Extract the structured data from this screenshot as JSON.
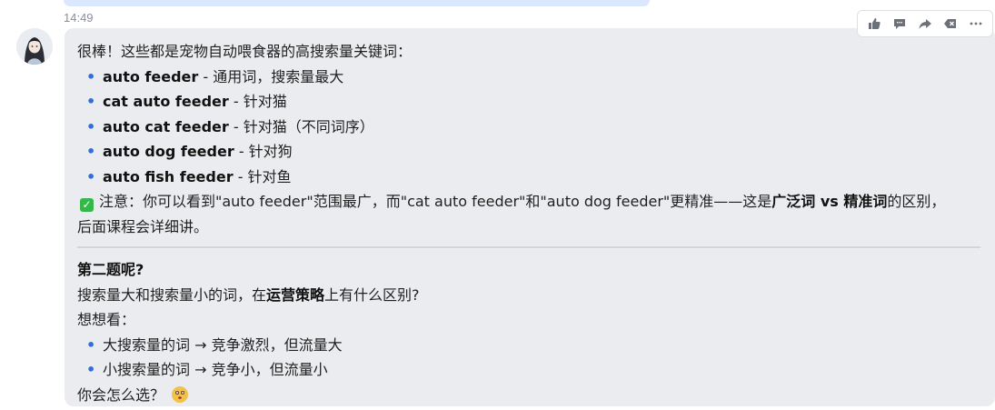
{
  "timestamp": "14:49",
  "toolbar": {
    "icons": [
      "thumbs-up-icon",
      "comment-icon",
      "share-icon",
      "backspace-icon",
      "more-icon"
    ]
  },
  "message": {
    "intro": "很棒！这些都是宠物自动喂食器的高搜索量关键词：",
    "keywords": [
      {
        "term": "auto feeder",
        "note": " - 通用词，搜索量最大"
      },
      {
        "term": "cat auto feeder",
        "note": " - 针对猫"
      },
      {
        "term": "auto cat feeder",
        "note": " - 针对猫（不同词序）"
      },
      {
        "term": "auto dog feeder",
        "note": " - 针对狗"
      },
      {
        "term": "auto fish feeder",
        "note": " - 针对鱼"
      }
    ],
    "note": {
      "part1": "注意：你可以看到\"auto feeder\"范围最广，而\"cat auto feeder\"和\"auto dog feeder\"更精准——这是",
      "bold": "广泛词 vs 精准词",
      "part2": "的区别，",
      "line2": "后面课程会详细讲。"
    },
    "q2": {
      "title": "第二题呢?",
      "question_part1": "搜索量大和搜索量小的词，在",
      "question_bold": "运营策略",
      "question_part2": "上有什么区别?",
      "prompt": "想想看：",
      "options": [
        "大搜索量的词 → 竞争激烈，但流量大",
        "小搜索量的词 → 竞争小，但流量小"
      ],
      "closing": "你会怎么选？"
    }
  },
  "colors": {
    "bubble": "#ebecef",
    "bullet": "#2f6fd8",
    "check": "#35b84a"
  }
}
